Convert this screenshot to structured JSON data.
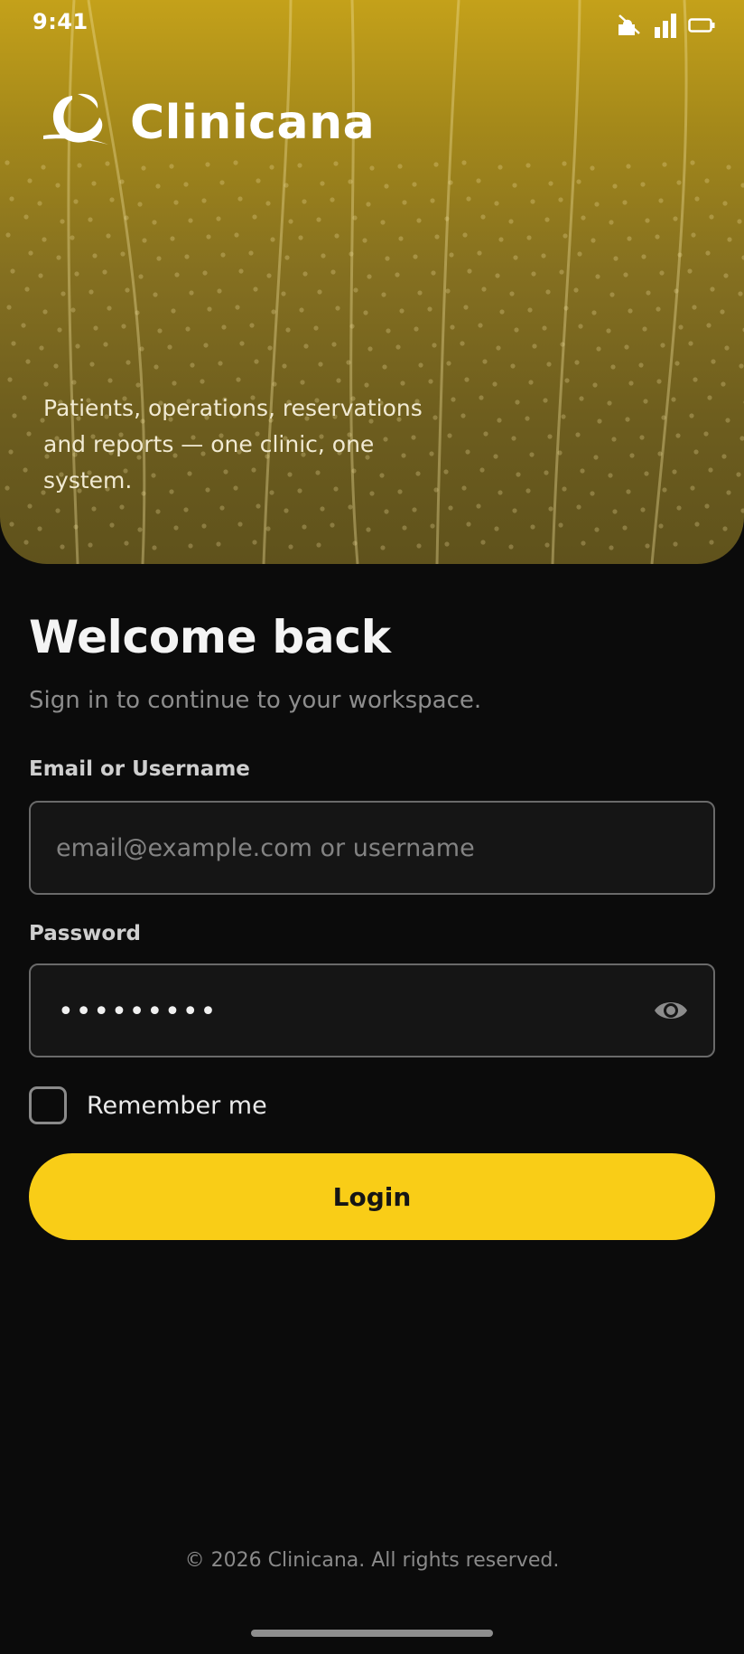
{
  "status_bar": {
    "time": "9:41",
    "icons": [
      "notification-icon",
      "signal-icon",
      "battery-icon"
    ]
  },
  "brand": {
    "name": "Clinicana",
    "logo_icon": "clinicana-logo-icon"
  },
  "hero": {
    "tagline": "Patients, operations, reservations and reports — one clinic, one system."
  },
  "login": {
    "title": "Welcome back",
    "subtitle": "Sign in to continue to your workspace.",
    "email_label": "Email or Username",
    "email_placeholder": "email@example.com or username",
    "email_value": "",
    "password_label": "Password",
    "password_masked": "•••••••••",
    "password_toggle_icon": "eye-icon",
    "remember_label": "Remember me",
    "remember_checked": false,
    "login_button": "Login"
  },
  "footer": {
    "copyright": "© 2026 Clinicana. All rights reserved."
  },
  "colors": {
    "accent": "#f9cd17",
    "background": "#0b0b0b",
    "hero_top": "#c4a11a",
    "hero_bottom": "#5f521c"
  }
}
